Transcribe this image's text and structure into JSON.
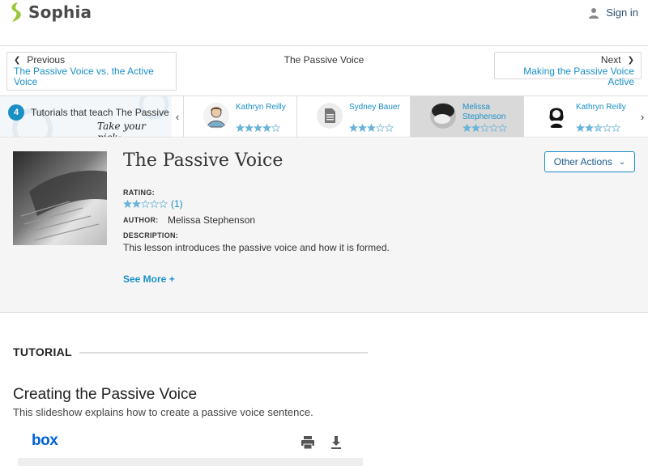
{
  "header": {
    "logo_text": "Sophia",
    "signin_label": "Sign in"
  },
  "nav": {
    "prev_label": "Previous",
    "prev_title": "The Passive Voice vs. the Active Voice",
    "current_title": "The Passive Voice",
    "next_label": "Next",
    "next_title": "Making the Passive Voice Active"
  },
  "strip": {
    "count": "4",
    "title": "Tutorials that teach The Passive",
    "pick_label": "Take your pick:",
    "cards": [
      {
        "name": "Kathryn Reilly",
        "rating": 4,
        "avatar": "illustrated-person",
        "active": false
      },
      {
        "name": "Sydney Bauer",
        "rating": 3,
        "avatar": "document-icon",
        "active": false
      },
      {
        "name": "Melissa Stephenson",
        "rating": 2,
        "avatar": "photo",
        "active": true
      },
      {
        "name": "Kathryn Reilly",
        "rating": 2.5,
        "avatar": "illustrated-person",
        "active": false
      }
    ]
  },
  "overview": {
    "title": "The Passive Voice",
    "other_actions_label": "Other Actions",
    "rating_label": "RATING:",
    "rating_value": 2,
    "rating_count": "(1)",
    "author_label": "AUTHOR:",
    "author_name": "Melissa Stephenson",
    "description_label": "DESCRIPTION:",
    "description": "This lesson introduces the passive voice and how it is formed.",
    "see_more_label": "See More +"
  },
  "tutorial": {
    "section_label": "TUTORIAL",
    "slideshow_title": "Creating the Passive Voice",
    "slideshow_desc": "This slideshow explains how to create a passive voice sentence.",
    "box_logo": "box"
  },
  "colors": {
    "accent": "#1a8fc6",
    "logo_green": "#9cc63a",
    "star_fill": "#6ab4d8"
  }
}
